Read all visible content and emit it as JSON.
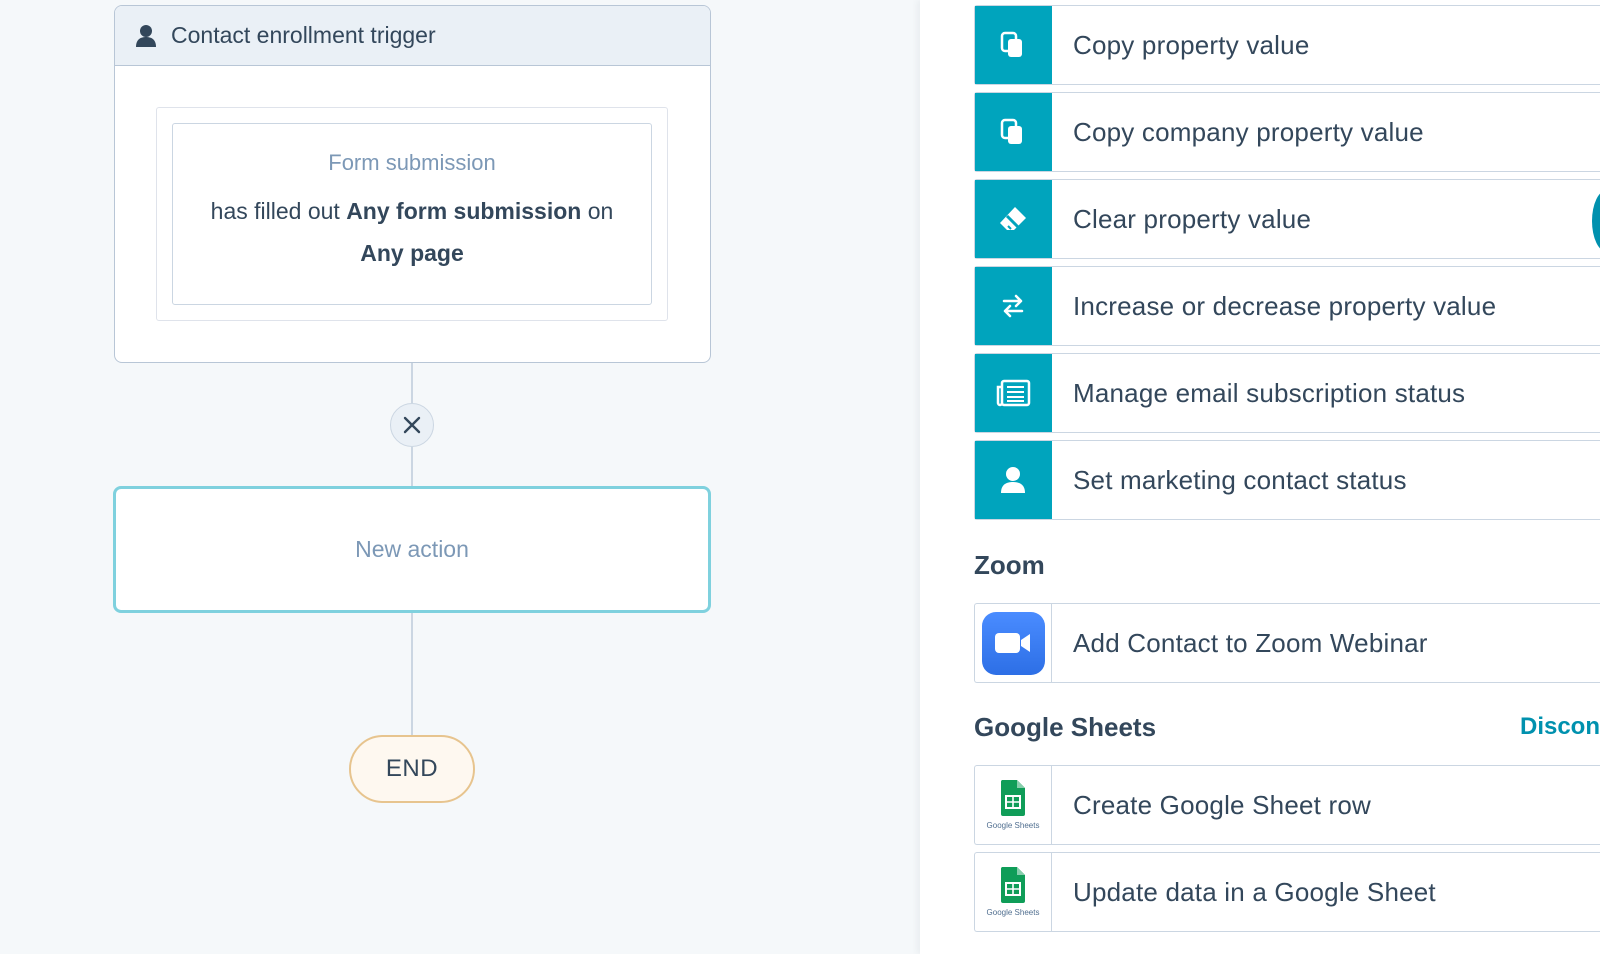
{
  "workflow": {
    "trigger": {
      "header": "Contact enrollment trigger",
      "type": "Form submission",
      "desc_prefix": "has filled out",
      "desc_bold1": "Any form submission",
      "desc_middle": "on",
      "desc_bold2": "Any page"
    },
    "new_action_label": "New action",
    "end_label": "END"
  },
  "panel": {
    "property_actions": [
      {
        "label": "Copy property value",
        "icon": "copy-icon"
      },
      {
        "label": "Copy company property value",
        "icon": "copy-icon"
      },
      {
        "label": "Clear property value",
        "icon": "eraser-icon"
      },
      {
        "label": "Increase or decrease property value",
        "icon": "swap-arrows-icon"
      },
      {
        "label": "Manage email subscription status",
        "icon": "newspaper-icon"
      },
      {
        "label": "Set marketing contact status",
        "icon": "contact-icon"
      }
    ],
    "zoom": {
      "title": "Zoom",
      "actions": [
        {
          "label": "Add Contact to Zoom Webinar",
          "icon": "zoom-video-icon"
        }
      ]
    },
    "google_sheets": {
      "title": "Google Sheets",
      "disconnect_label": "Discon",
      "logo_caption": "Google Sheets",
      "actions": [
        {
          "label": "Create Google Sheet row",
          "icon": "google-sheets-icon"
        },
        {
          "label": "Update data in a Google Sheet",
          "icon": "google-sheets-icon"
        }
      ]
    }
  },
  "colors": {
    "teal": "#00a4bd",
    "text": "#33475b",
    "muted": "#7c98b6",
    "link": "#0091ae",
    "zoom_blue": "#2d8cff",
    "sheets_green": "#0f9d58"
  }
}
